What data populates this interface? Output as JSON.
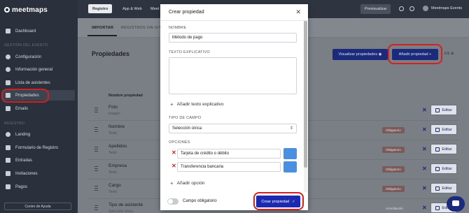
{
  "brand": {
    "logo_text": "meetmaps"
  },
  "sidebar": {
    "sections": {
      "event": "GESTIÓN DEL EVENTO",
      "registro": "REGISTRO"
    },
    "items": [
      {
        "label": "Dashboard",
        "icon": "grid-icon"
      },
      {
        "label": "Configuración",
        "icon": "gear-icon"
      },
      {
        "label": "Información general",
        "icon": "info-icon"
      },
      {
        "label": "Lista de asistentes",
        "icon": "users-icon"
      },
      {
        "label": "Propiedades",
        "icon": "list-icon"
      },
      {
        "label": "Emails",
        "icon": "mail-icon"
      },
      {
        "label": "Landing",
        "icon": "globe-icon"
      },
      {
        "label": "Formulario de Registro",
        "icon": "form-icon"
      },
      {
        "label": "Entradas",
        "icon": "ticket-icon"
      },
      {
        "label": "Invitaciones",
        "icon": "envelope-icon"
      },
      {
        "label": "Pagos",
        "icon": "card-icon"
      }
    ],
    "help_label": "Centro de Ayuda"
  },
  "topbar": {
    "tabs": [
      "Registro",
      "App & Web",
      "Meet"
    ],
    "preview_label": "Previsualizar",
    "account_name": "Meetmaps Events"
  },
  "subtabs": [
    "IMPORTAR",
    "REGISTROS ON-SITE"
  ],
  "page": {
    "title": "Propiedades",
    "visualize_label": "Visualizar propiedades",
    "add_label": "Añadir propiedad",
    "lang": "ES",
    "column_header": "Nombre propiedad"
  },
  "rows": [
    {
      "name": "Foto",
      "type": "Imagen",
      "badge": ""
    },
    {
      "name": "Nombre",
      "type": "Texto",
      "badge": "Obligatorio"
    },
    {
      "name": "Apellidos",
      "type": "Texto",
      "badge": "Obligatorio"
    },
    {
      "name": "Empresa",
      "type": "Texto",
      "badge": "Obligatorio"
    },
    {
      "name": "Cargo",
      "type": "Texto",
      "badge": "Obligatorio"
    },
    {
      "name": "Tipo de asistente",
      "type": "Selección única",
      "badge": "Acreditación"
    }
  ],
  "edit_label": "Editar",
  "modal": {
    "title": "Crear propiedad",
    "name_label": "NOMBRE",
    "name_value": "Método de pago",
    "explain_label": "TEXTO EXPLICATIVO",
    "add_explain_label": "Añadir texto explicativo",
    "field_type_label": "TIPO DE CAMPO",
    "field_type_value": "Selección única",
    "options_label": "OPCIONES",
    "options": [
      "Tarjeta de crédito o débito",
      "Transferencia bancaria"
    ],
    "add_option_label": "Añadir opción",
    "required_label": "Campo obligatorio",
    "create_label": "Crear propiedad"
  }
}
